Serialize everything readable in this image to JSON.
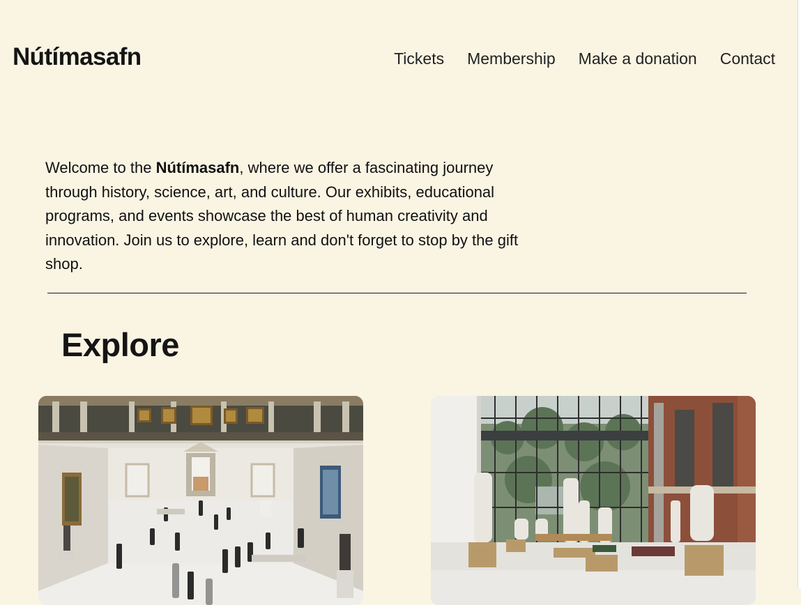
{
  "site": {
    "logo": "Nútímasafn"
  },
  "nav": {
    "items": [
      {
        "label": "Tickets"
      },
      {
        "label": "Membership"
      },
      {
        "label": "Make a donation"
      },
      {
        "label": "Contact"
      }
    ]
  },
  "intro": {
    "before": "Welcome to the ",
    "highlight": "Nútímasafn",
    "after": ", where we offer a fascinating journey through history, science, art, and culture. Our exhibits, educational programs, and events showcase the best of human creativity and innovation. Join us to explore, learn and don't forget to stop by the gift shop."
  },
  "explore": {
    "title": "Explore"
  },
  "colors": {
    "background": "#faf4e3",
    "text": "#151515"
  }
}
